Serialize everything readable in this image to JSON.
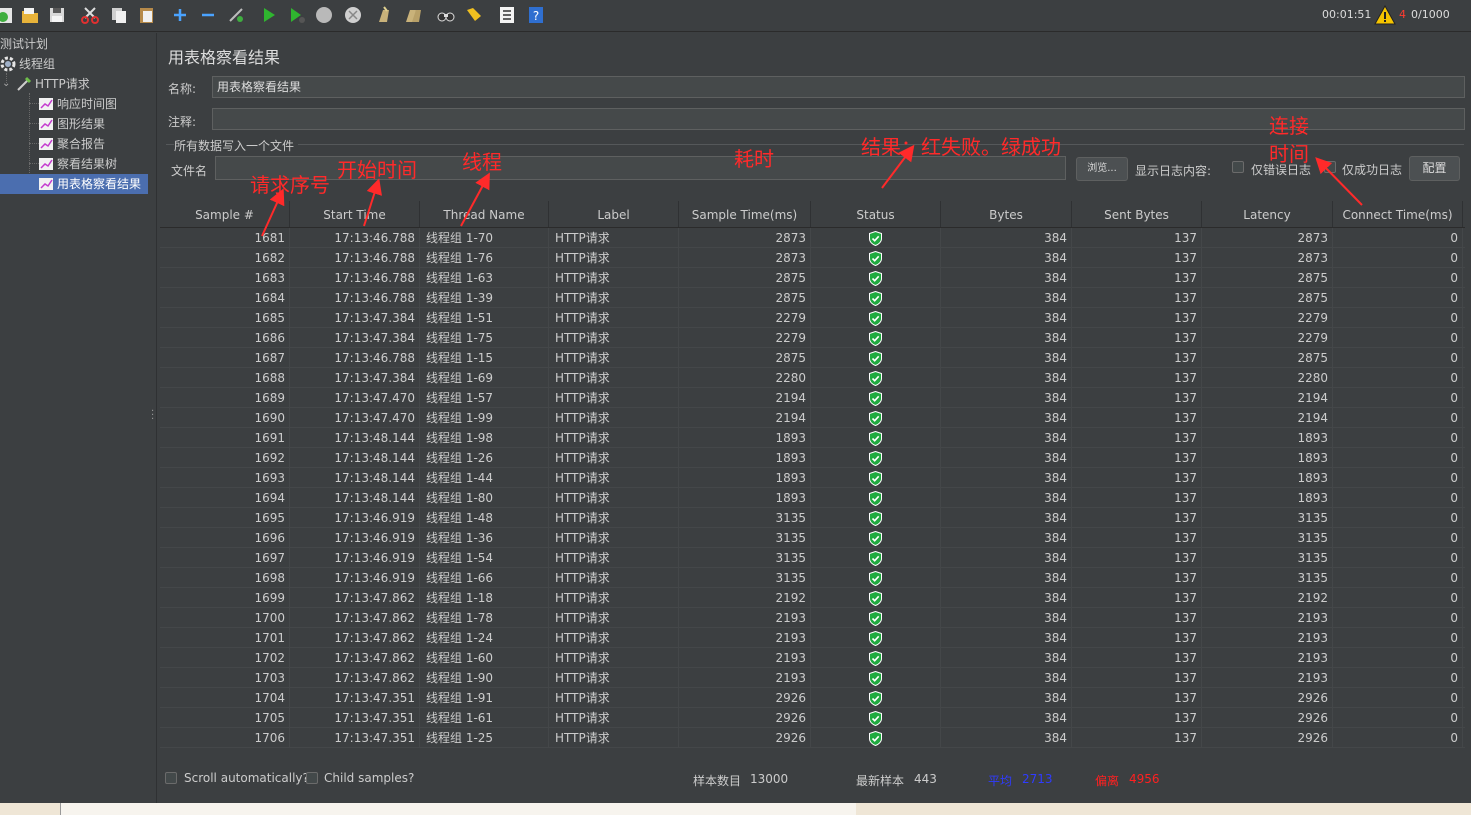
{
  "toolbar": {
    "icons": [
      "new-plan-icon",
      "open-icon",
      "save-icon",
      "cut-icon",
      "copy-icon",
      "paste-icon",
      "expand-icon",
      "collapse-icon",
      "toggle-icon",
      "start-icon",
      "start-no-pause-icon",
      "stop-icon",
      "shutdown-icon",
      "clear-icon",
      "clear-all-icon",
      "search-icon",
      "reset-search-icon",
      "function-helper-icon",
      "help-icon"
    ],
    "timer": "00:01:51",
    "error_count": "4",
    "threads": "0/1000"
  },
  "tree": {
    "items": [
      {
        "label": "测试计划"
      },
      {
        "label": "线程组"
      },
      {
        "label": "HTTP请求"
      },
      {
        "label": "响应时间图"
      },
      {
        "label": "图形结果"
      },
      {
        "label": "聚合报告"
      },
      {
        "label": "察看结果树"
      },
      {
        "label": "用表格察看结果"
      }
    ]
  },
  "panel": {
    "title": "用表格察看结果",
    "name_label": "名称:",
    "name_value": "用表格察看结果",
    "comment_label": "注释:",
    "comment_value": "",
    "file_group": "所有数据写入一个文件",
    "filename_label": "文件名",
    "filename_value": "",
    "browse_button": "浏览...",
    "log_content_label": "显示日志内容:",
    "errors_only_label": "仅错误日志",
    "success_only_label": "仅成功日志",
    "configure_button": "配置"
  },
  "table": {
    "columns": [
      "Sample #",
      "Start Time",
      "Thread Name",
      "Label",
      "Sample Time(ms)",
      "Status",
      "Bytes",
      "Sent Bytes",
      "Latency",
      "Connect Time(ms)"
    ],
    "rows": [
      [
        "1681",
        "17:13:46.788",
        "线程组 1-70",
        "HTTP请求",
        "2873",
        "success",
        "384",
        "137",
        "2873",
        "0"
      ],
      [
        "1682",
        "17:13:46.788",
        "线程组 1-76",
        "HTTP请求",
        "2873",
        "success",
        "384",
        "137",
        "2873",
        "0"
      ],
      [
        "1683",
        "17:13:46.788",
        "线程组 1-63",
        "HTTP请求",
        "2875",
        "success",
        "384",
        "137",
        "2875",
        "0"
      ],
      [
        "1684",
        "17:13:46.788",
        "线程组 1-39",
        "HTTP请求",
        "2875",
        "success",
        "384",
        "137",
        "2875",
        "0"
      ],
      [
        "1685",
        "17:13:47.384",
        "线程组 1-51",
        "HTTP请求",
        "2279",
        "success",
        "384",
        "137",
        "2279",
        "0"
      ],
      [
        "1686",
        "17:13:47.384",
        "线程组 1-75",
        "HTTP请求",
        "2279",
        "success",
        "384",
        "137",
        "2279",
        "0"
      ],
      [
        "1687",
        "17:13:46.788",
        "线程组 1-15",
        "HTTP请求",
        "2875",
        "success",
        "384",
        "137",
        "2875",
        "0"
      ],
      [
        "1688",
        "17:13:47.384",
        "线程组 1-69",
        "HTTP请求",
        "2280",
        "success",
        "384",
        "137",
        "2280",
        "0"
      ],
      [
        "1689",
        "17:13:47.470",
        "线程组 1-57",
        "HTTP请求",
        "2194",
        "success",
        "384",
        "137",
        "2194",
        "0"
      ],
      [
        "1690",
        "17:13:47.470",
        "线程组 1-99",
        "HTTP请求",
        "2194",
        "success",
        "384",
        "137",
        "2194",
        "0"
      ],
      [
        "1691",
        "17:13:48.144",
        "线程组 1-98",
        "HTTP请求",
        "1893",
        "success",
        "384",
        "137",
        "1893",
        "0"
      ],
      [
        "1692",
        "17:13:48.144",
        "线程组 1-26",
        "HTTP请求",
        "1893",
        "success",
        "384",
        "137",
        "1893",
        "0"
      ],
      [
        "1693",
        "17:13:48.144",
        "线程组 1-44",
        "HTTP请求",
        "1893",
        "success",
        "384",
        "137",
        "1893",
        "0"
      ],
      [
        "1694",
        "17:13:48.144",
        "线程组 1-80",
        "HTTP请求",
        "1893",
        "success",
        "384",
        "137",
        "1893",
        "0"
      ],
      [
        "1695",
        "17:13:46.919",
        "线程组 1-48",
        "HTTP请求",
        "3135",
        "success",
        "384",
        "137",
        "3135",
        "0"
      ],
      [
        "1696",
        "17:13:46.919",
        "线程组 1-36",
        "HTTP请求",
        "3135",
        "success",
        "384",
        "137",
        "3135",
        "0"
      ],
      [
        "1697",
        "17:13:46.919",
        "线程组 1-54",
        "HTTP请求",
        "3135",
        "success",
        "384",
        "137",
        "3135",
        "0"
      ],
      [
        "1698",
        "17:13:46.919",
        "线程组 1-66",
        "HTTP请求",
        "3135",
        "success",
        "384",
        "137",
        "3135",
        "0"
      ],
      [
        "1699",
        "17:13:47.862",
        "线程组 1-18",
        "HTTP请求",
        "2192",
        "success",
        "384",
        "137",
        "2192",
        "0"
      ],
      [
        "1700",
        "17:13:47.862",
        "线程组 1-78",
        "HTTP请求",
        "2193",
        "success",
        "384",
        "137",
        "2193",
        "0"
      ],
      [
        "1701",
        "17:13:47.862",
        "线程组 1-24",
        "HTTP请求",
        "2193",
        "success",
        "384",
        "137",
        "2193",
        "0"
      ],
      [
        "1702",
        "17:13:47.862",
        "线程组 1-60",
        "HTTP请求",
        "2193",
        "success",
        "384",
        "137",
        "2193",
        "0"
      ],
      [
        "1703",
        "17:13:47.862",
        "线程组 1-90",
        "HTTP请求",
        "2193",
        "success",
        "384",
        "137",
        "2193",
        "0"
      ],
      [
        "1704",
        "17:13:47.351",
        "线程组 1-91",
        "HTTP请求",
        "2926",
        "success",
        "384",
        "137",
        "2926",
        "0"
      ],
      [
        "1705",
        "17:13:47.351",
        "线程组 1-61",
        "HTTP请求",
        "2926",
        "success",
        "384",
        "137",
        "2926",
        "0"
      ],
      [
        "1706",
        "17:13:47.351",
        "线程组 1-25",
        "HTTP请求",
        "2926",
        "success",
        "384",
        "137",
        "2926",
        "0"
      ]
    ]
  },
  "bottom": {
    "scroll_auto": "Scroll automatically?",
    "child_samples": "Child samples?",
    "sample_count_label": "样本数目",
    "sample_count": "13000",
    "latest_sample_label": "最新样本",
    "latest_sample": "443",
    "average_label": "平均",
    "average": "2713",
    "deviation_label": "偏离",
    "deviation": "4956"
  },
  "annotations": {
    "sample_no": "请求序号",
    "start_time": "开始时间",
    "thread": "线程",
    "elapsed": "耗时",
    "result": "结果：红失败。绿成功",
    "connect_line1": "连接",
    "connect_line2": "时间"
  },
  "colors": {
    "annotation": "#ff2a2a",
    "average": "#2f3bff",
    "deviation": "#ff2020",
    "selected": "#4b6eaf"
  }
}
